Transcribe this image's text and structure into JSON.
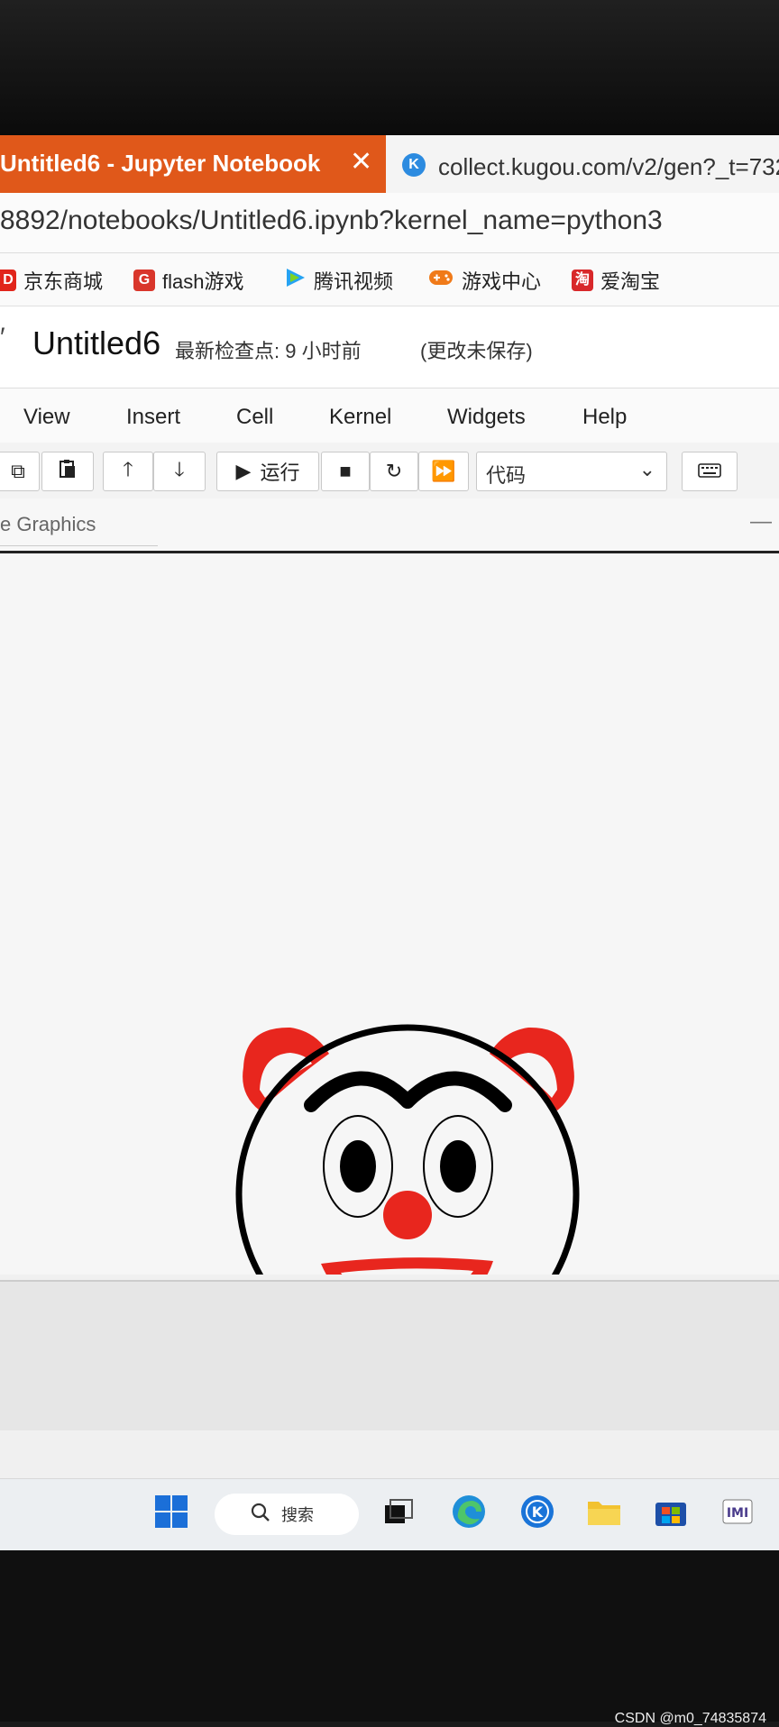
{
  "browser": {
    "active_tab": {
      "title": "Untitled6 - Jupyter Notebook"
    },
    "second_tab": {
      "title": "collect.kugou.com/v2/gen?_t=732",
      "icon": "kugou-icon"
    },
    "url": "8892/notebooks/Untitled6.ipynb?kernel_name=python3",
    "bookmarks": [
      {
        "label": "京东商城",
        "icon": "jd-icon",
        "color": "#e1251b"
      },
      {
        "label": "flash游戏",
        "icon": "flash-games-icon",
        "color": "#d9362b"
      },
      {
        "label": "腾讯视频",
        "icon": "tencent-video-icon",
        "color": "#26a3f2"
      },
      {
        "label": "游戏中心",
        "icon": "game-center-icon",
        "color": "#f07a19"
      },
      {
        "label": "爱淘宝",
        "icon": "taobao-icon",
        "color": "#d8282a"
      }
    ]
  },
  "notebook": {
    "title": "Untitled6",
    "checkpoint": "最新检查点: 9 小时前",
    "save_status": "(更改未保存)"
  },
  "menu": [
    "View",
    "Insert",
    "Cell",
    "Kernel",
    "Widgets",
    "Help"
  ],
  "toolbar": {
    "run_label": "运行",
    "cell_type": "代码"
  },
  "output": {
    "label": "e Graphics",
    "minimize": "—"
  },
  "drawing": {
    "subject": "clown face",
    "outline_color": "#000000",
    "accent_color": "#e8261e"
  },
  "taskbar": {
    "search_label": "搜索"
  },
  "watermark": "CSDN @m0_74835874"
}
